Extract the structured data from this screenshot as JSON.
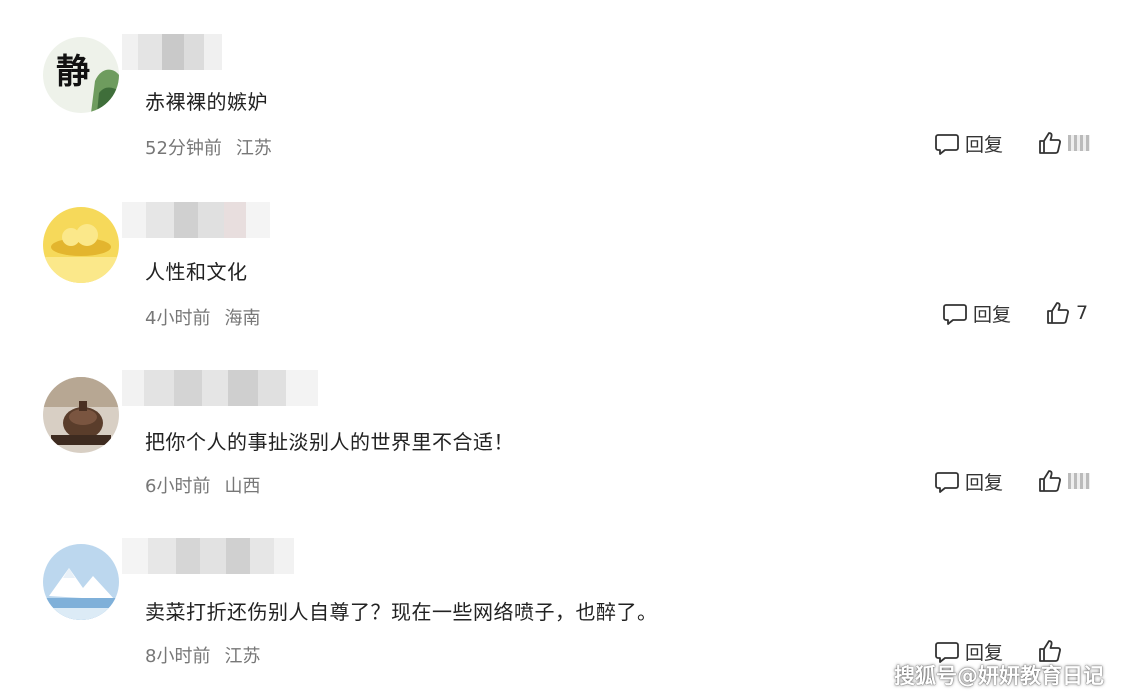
{
  "reply_label": "回复",
  "comments": [
    {
      "text": "赤裸裸的嫉妒",
      "time": "52分钟前",
      "location": "江苏",
      "like_count": ""
    },
    {
      "text": "人性和文化",
      "time": "4小时前",
      "location": "海南",
      "like_count": "7"
    },
    {
      "text": "把你个人的事扯淡别人的世界里不合适！",
      "time": "6小时前",
      "location": "山西",
      "like_count": ""
    },
    {
      "text": "卖菜打折还伤别人自尊了？现在一些网络喷子，也醉了。",
      "time": "8小时前",
      "location": "江苏",
      "like_count": ""
    }
  ],
  "avatar_1_char": "静",
  "watermark": "搜狐号@妍妍教育日记",
  "colors": {
    "text": "#222222",
    "meta": "#777777",
    "icon": "#333333"
  }
}
